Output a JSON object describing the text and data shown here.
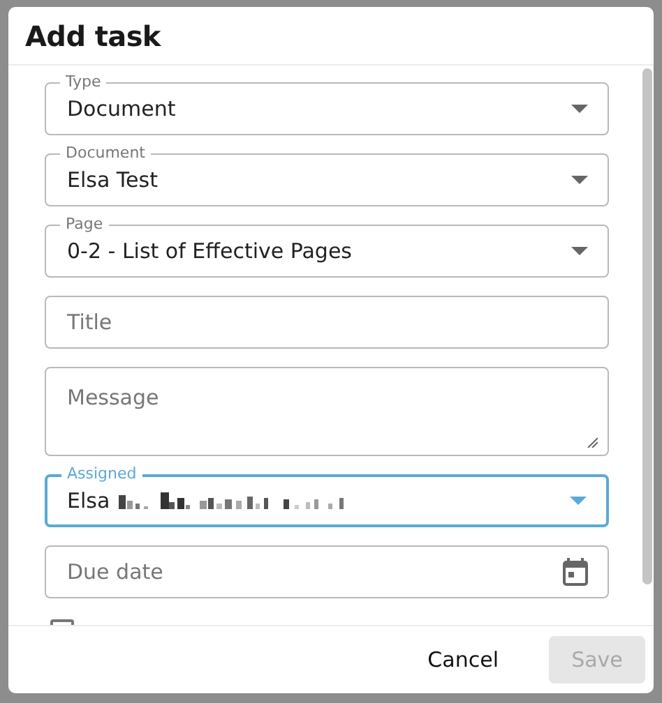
{
  "dialog": {
    "title": "Add task"
  },
  "fields": [
    {
      "kind": "select",
      "label": "Type",
      "value": "Document",
      "focused": false
    },
    {
      "kind": "select",
      "label": "Document",
      "value": "Elsa Test",
      "focused": false
    },
    {
      "kind": "select",
      "label": "Page",
      "value": "0-2 - List of Effective Pages",
      "focused": false
    },
    {
      "kind": "text",
      "placeholder": "Title"
    },
    {
      "kind": "textarea",
      "placeholder": "Message"
    },
    {
      "kind": "select",
      "label": "Assigned",
      "value": "Elsa",
      "redacted": true,
      "focused": true
    },
    {
      "kind": "date",
      "placeholder": "Due date"
    }
  ],
  "checkbox": {
    "checked": false
  },
  "buttons": [
    {
      "label": "Cancel",
      "disabled": false,
      "kind": "text"
    },
    {
      "label": "Save",
      "disabled": true,
      "kind": "contained"
    }
  ]
}
